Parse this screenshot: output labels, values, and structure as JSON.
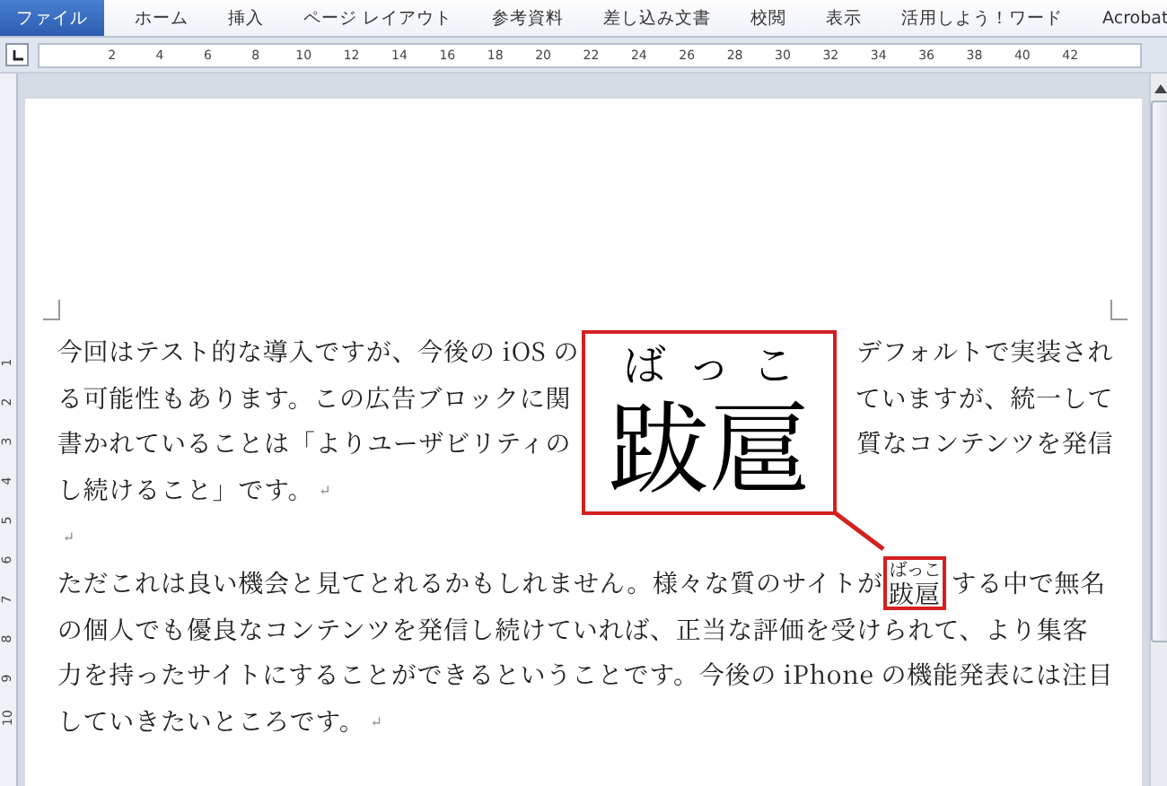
{
  "ribbon": {
    "tabs": [
      {
        "label": "ファイル",
        "selected": true
      },
      {
        "label": "ホーム",
        "selected": false
      },
      {
        "label": "挿入",
        "selected": false
      },
      {
        "label": "ページ レイアウト",
        "selected": false
      },
      {
        "label": "参考資料",
        "selected": false
      },
      {
        "label": "差し込み文書",
        "selected": false
      },
      {
        "label": "校閲",
        "selected": false
      },
      {
        "label": "表示",
        "selected": false
      },
      {
        "label": "活用しよう！ワード",
        "selected": false
      },
      {
        "label": "Acrobat",
        "selected": false
      }
    ]
  },
  "ruler": {
    "labels": [
      "2",
      "4",
      "6",
      "8",
      "10",
      "12",
      "14",
      "16",
      "18",
      "20",
      "22",
      "24",
      "26",
      "28",
      "30",
      "32",
      "34",
      "36",
      "38",
      "40",
      "42"
    ]
  },
  "vertical_ruler": {
    "labels": [
      "1",
      "2",
      "3",
      "4",
      "5",
      "6",
      "7",
      "8",
      "9",
      "10"
    ]
  },
  "document": {
    "lines": [
      {
        "kind": "split",
        "left": "今回はテスト的な導入ですが、今後の iOS の",
        "right": "デフォルトで実装され"
      },
      {
        "kind": "split",
        "left": "る可能性もあります。この広告ブロックに関",
        "right": "ていますが、統一して"
      },
      {
        "kind": "split",
        "left": "書かれていることは「よりユーザビリティの",
        "right": "質なコンテンツを発信"
      },
      {
        "kind": "plain",
        "text": "し続けること」です。",
        "end_mark": "↵"
      },
      {
        "kind": "plain",
        "end_mark": "↵"
      },
      {
        "kind": "ruby",
        "before": "ただこれは良い機会と見てとれるかもしれません。様々な質のサイトが",
        "base": "跋扈",
        "reading": "ばっこ",
        "after": "する中で無名"
      },
      {
        "kind": "plain",
        "text": "の個人でも優良なコンテンツを発信し続けていれば、正当な評価を受けられて、より集客"
      },
      {
        "kind": "plain",
        "text": "力を持ったサイトにすることができるということです。今後の iPhone の機能発表には注目"
      },
      {
        "kind": "plain",
        "text": "していきたいところです。",
        "end_mark": "↵"
      }
    ]
  },
  "callout": {
    "reading": "ばっこ",
    "base": "跋扈"
  }
}
